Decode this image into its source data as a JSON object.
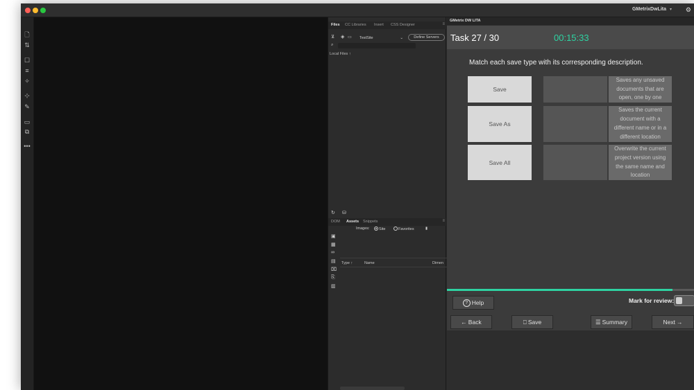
{
  "window": {
    "app_name": "GMetrixDwLita"
  },
  "toolbar": {
    "icons": [
      "new-document-icon",
      "code-navigator-icon",
      "file-management-icon",
      "format-source-icon",
      "live-view-icon",
      "apply-source-icon",
      "wrap-tag-icon",
      "comment-icon",
      "collapse-icon",
      "more-options-icon"
    ]
  },
  "files_panel": {
    "tabs": [
      "Files",
      "CC Libraries",
      "Insert",
      "CSS Designer"
    ],
    "site_name": "TestSite",
    "define_servers": "Define Servers",
    "local_files": "Local Files",
    "bottom_tabs": [
      "DOM",
      "Assets",
      "Snippets"
    ],
    "images_label": "Images:",
    "radio_site": "Site",
    "radio_favorites": "Favorites",
    "columns": [
      "Type",
      "Name",
      "Dimen"
    ]
  },
  "gmetrix": {
    "panel_title": "GMetrix DW LITA",
    "task": "Task 27 / 30",
    "timer": "00:15:33",
    "question": "Match each save type with its corresponding description.",
    "options": [
      "Save",
      "Save As",
      "Save All"
    ],
    "descriptions": [
      "Saves any unsaved documents that are open, one by one",
      "Saves the current document with a different name or in a different location",
      "Overwrite the current project version using the same name and location"
    ],
    "progress": 0.913,
    "help_label": "Help",
    "mark_for_review": "Mark for review:",
    "back_label": "Back",
    "save_label": "Save",
    "summary_label": "Summary",
    "next_label": "Next",
    "accent_color": "#2ed3a2"
  }
}
